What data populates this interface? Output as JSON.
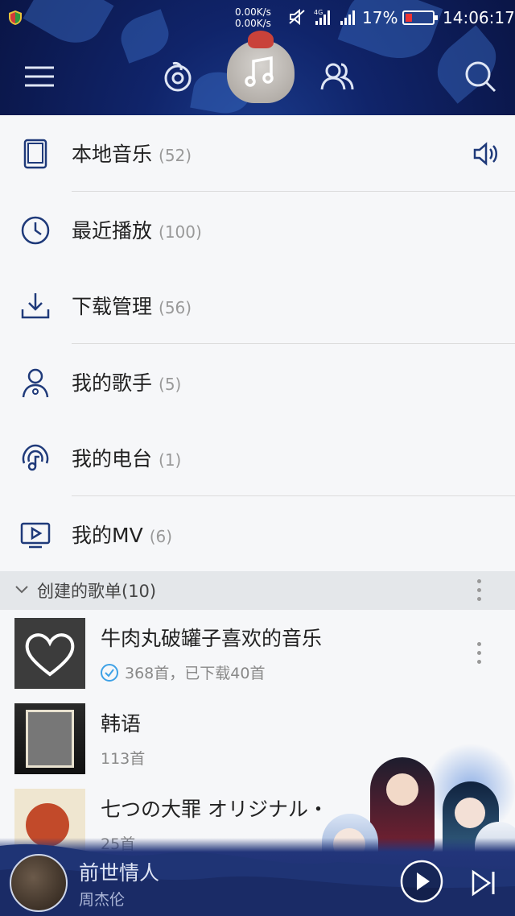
{
  "status": {
    "speed_up": "0.00K/s",
    "speed_down": "0.00K/s",
    "network": "4G",
    "battery": "17%",
    "time": "14:06:17"
  },
  "menu": [
    {
      "label": "本地音乐",
      "count": "(52)",
      "icon": "phone-icon"
    },
    {
      "label": "最近播放",
      "count": "(100)",
      "icon": "clock-icon"
    },
    {
      "label": "下载管理",
      "count": "(56)",
      "icon": "download-icon"
    },
    {
      "label": "我的歌手",
      "count": "(5)",
      "icon": "singer-icon"
    },
    {
      "label": "我的电台",
      "count": "(1)",
      "icon": "radio-icon"
    },
    {
      "label": "我的MV",
      "count": "(6)",
      "icon": "tv-icon"
    }
  ],
  "section": {
    "title": "创建的歌单(10)"
  },
  "playlists": [
    {
      "name": "牛肉丸破罐子喜欢的音乐",
      "sub": "368首，已下载40首"
    },
    {
      "name": "韩语",
      "sub": "113首"
    },
    {
      "name": "七つの大罪 オリジナル・",
      "sub": "25首"
    }
  ],
  "player": {
    "song": "前世情人",
    "artist": "周杰伦"
  },
  "colors": {
    "accent": "#1f3a7a",
    "topbar": "#10246a",
    "check": "#3ea1e6"
  }
}
